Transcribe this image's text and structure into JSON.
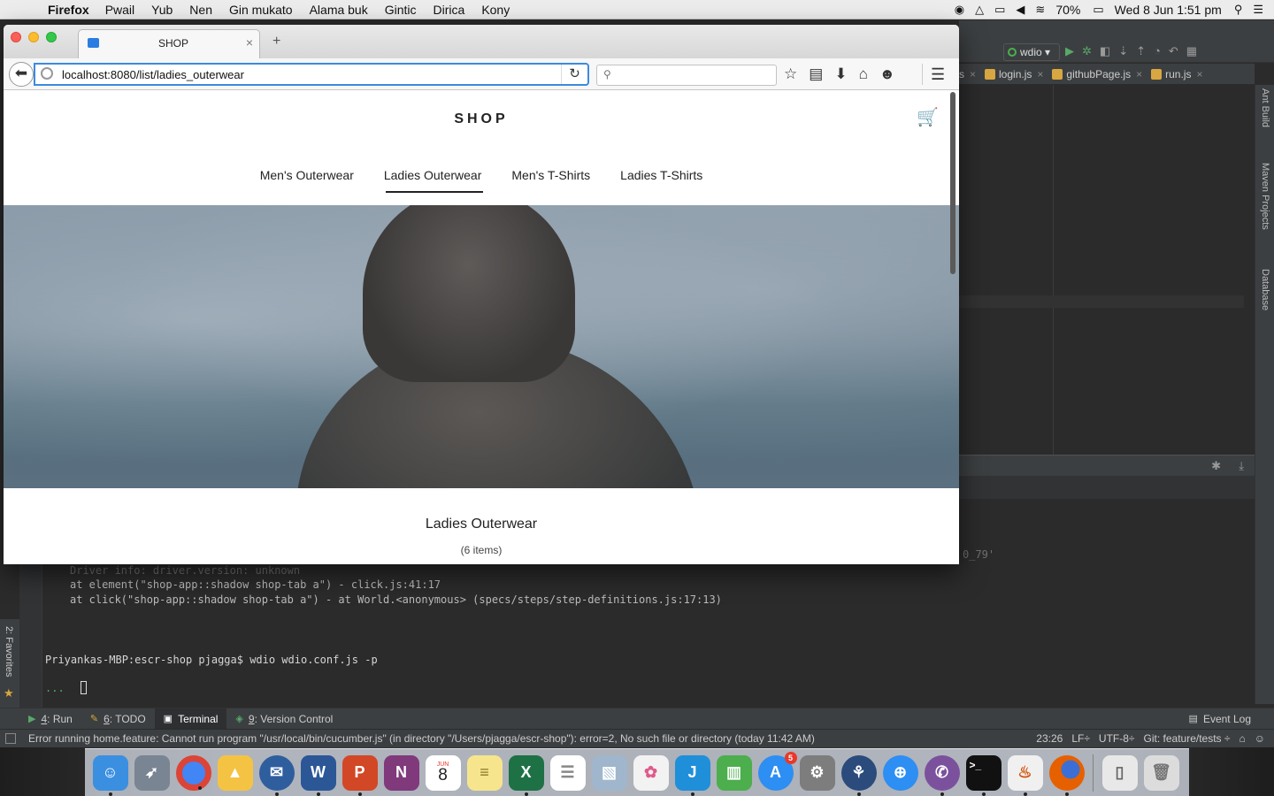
{
  "menubar": {
    "app": "Firefox",
    "items": [
      "Pwail",
      "Yub",
      "Nen",
      "Gin mukato",
      "Alama buk",
      "Gintic",
      "Dirica",
      "Kony"
    ],
    "battery": "70%",
    "datetime": "Wed 8 Jun  1:51 pm"
  },
  "browser": {
    "tab_title": "SHOP",
    "url": "localhost:8080/list/ladies_outerwear",
    "search_placeholder": ""
  },
  "shop": {
    "title": "SHOP",
    "categories": [
      "Men's Outerwear",
      "Ladies Outerwear",
      "Men's T-Shirts",
      "Ladies T-Shirts"
    ],
    "active_category": "Ladies Outerwear",
    "heading": "Ladies Outerwear",
    "count": "(6 items)"
  },
  "ide": {
    "run_config": "wdio",
    "tabs": [
      "s",
      "login.js",
      "githubPage.js",
      "run.js"
    ],
    "right_tools": [
      "Ant Build",
      "Maven Projects",
      "Database"
    ],
    "terminal_lines": [
      "Driver info: driver.version: unknown",
      "at element(\"shop-app::shadow shop-tab a\") - click.js:41:17",
      "at click(\"shop-app::shadow shop-tab a\") - at World.<anonymous> (specs/steps/step-definitions.js:17:13)"
    ],
    "terminal_extra": "0_79'",
    "prompt": "Priyankas-MBP:escr-shop pjagga$ wdio wdio.conf.js -p",
    "cursor_prefix": "...",
    "favorites": "2: Favorites",
    "bottom_tabs": [
      {
        "key": "4",
        "label": ": Run"
      },
      {
        "key": "6",
        "label": ": TODO"
      },
      {
        "key": "",
        "label": "Terminal"
      },
      {
        "key": "9",
        "label": ": Version Control"
      }
    ],
    "event_log": "Event Log",
    "status_message": "Error running home.feature: Cannot run program \"/usr/local/bin/cucumber.js\" (in directory \"/Users/pjagga/escr-shop\"): error=2, No such file or directory (today 11:42 AM)",
    "status_right": [
      "23:26",
      "LF÷",
      "UTF-8÷",
      "Git: feature/tests ÷"
    ]
  },
  "dock": {
    "calendar_month": "JUN",
    "calendar_day": "8",
    "appstore_badge": "5",
    "colors": {
      "finder": "#3b8fe0",
      "launchpad": "#7a8593",
      "chrome": "#e9e9e9",
      "drive": "#f5c343",
      "thunderbird": "#2f5e9e",
      "word": "#2b5797",
      "powerpoint": "#d24726",
      "onenote": "#80397b",
      "calendar": "#ffffff",
      "notes": "#f6e58d",
      "excel": "#1e7145",
      "reminders": "#ffffff",
      "preview": "#9fb6cd",
      "photos": "#f2f2f2",
      "intellij": "#1f8fd9",
      "numbers": "#4cae4c",
      "appstore": "#2d8ef3",
      "sysprefs": "#7d7d7d",
      "sourcetree": "#2a4b7c",
      "safari": "#2d8ef3",
      "viber": "#7b519d",
      "terminal": "#111111",
      "java": "#f0f0f0",
      "firefox": "#e66000",
      "doc": "#e8e8e8",
      "trash": "#dcdcdc"
    }
  }
}
